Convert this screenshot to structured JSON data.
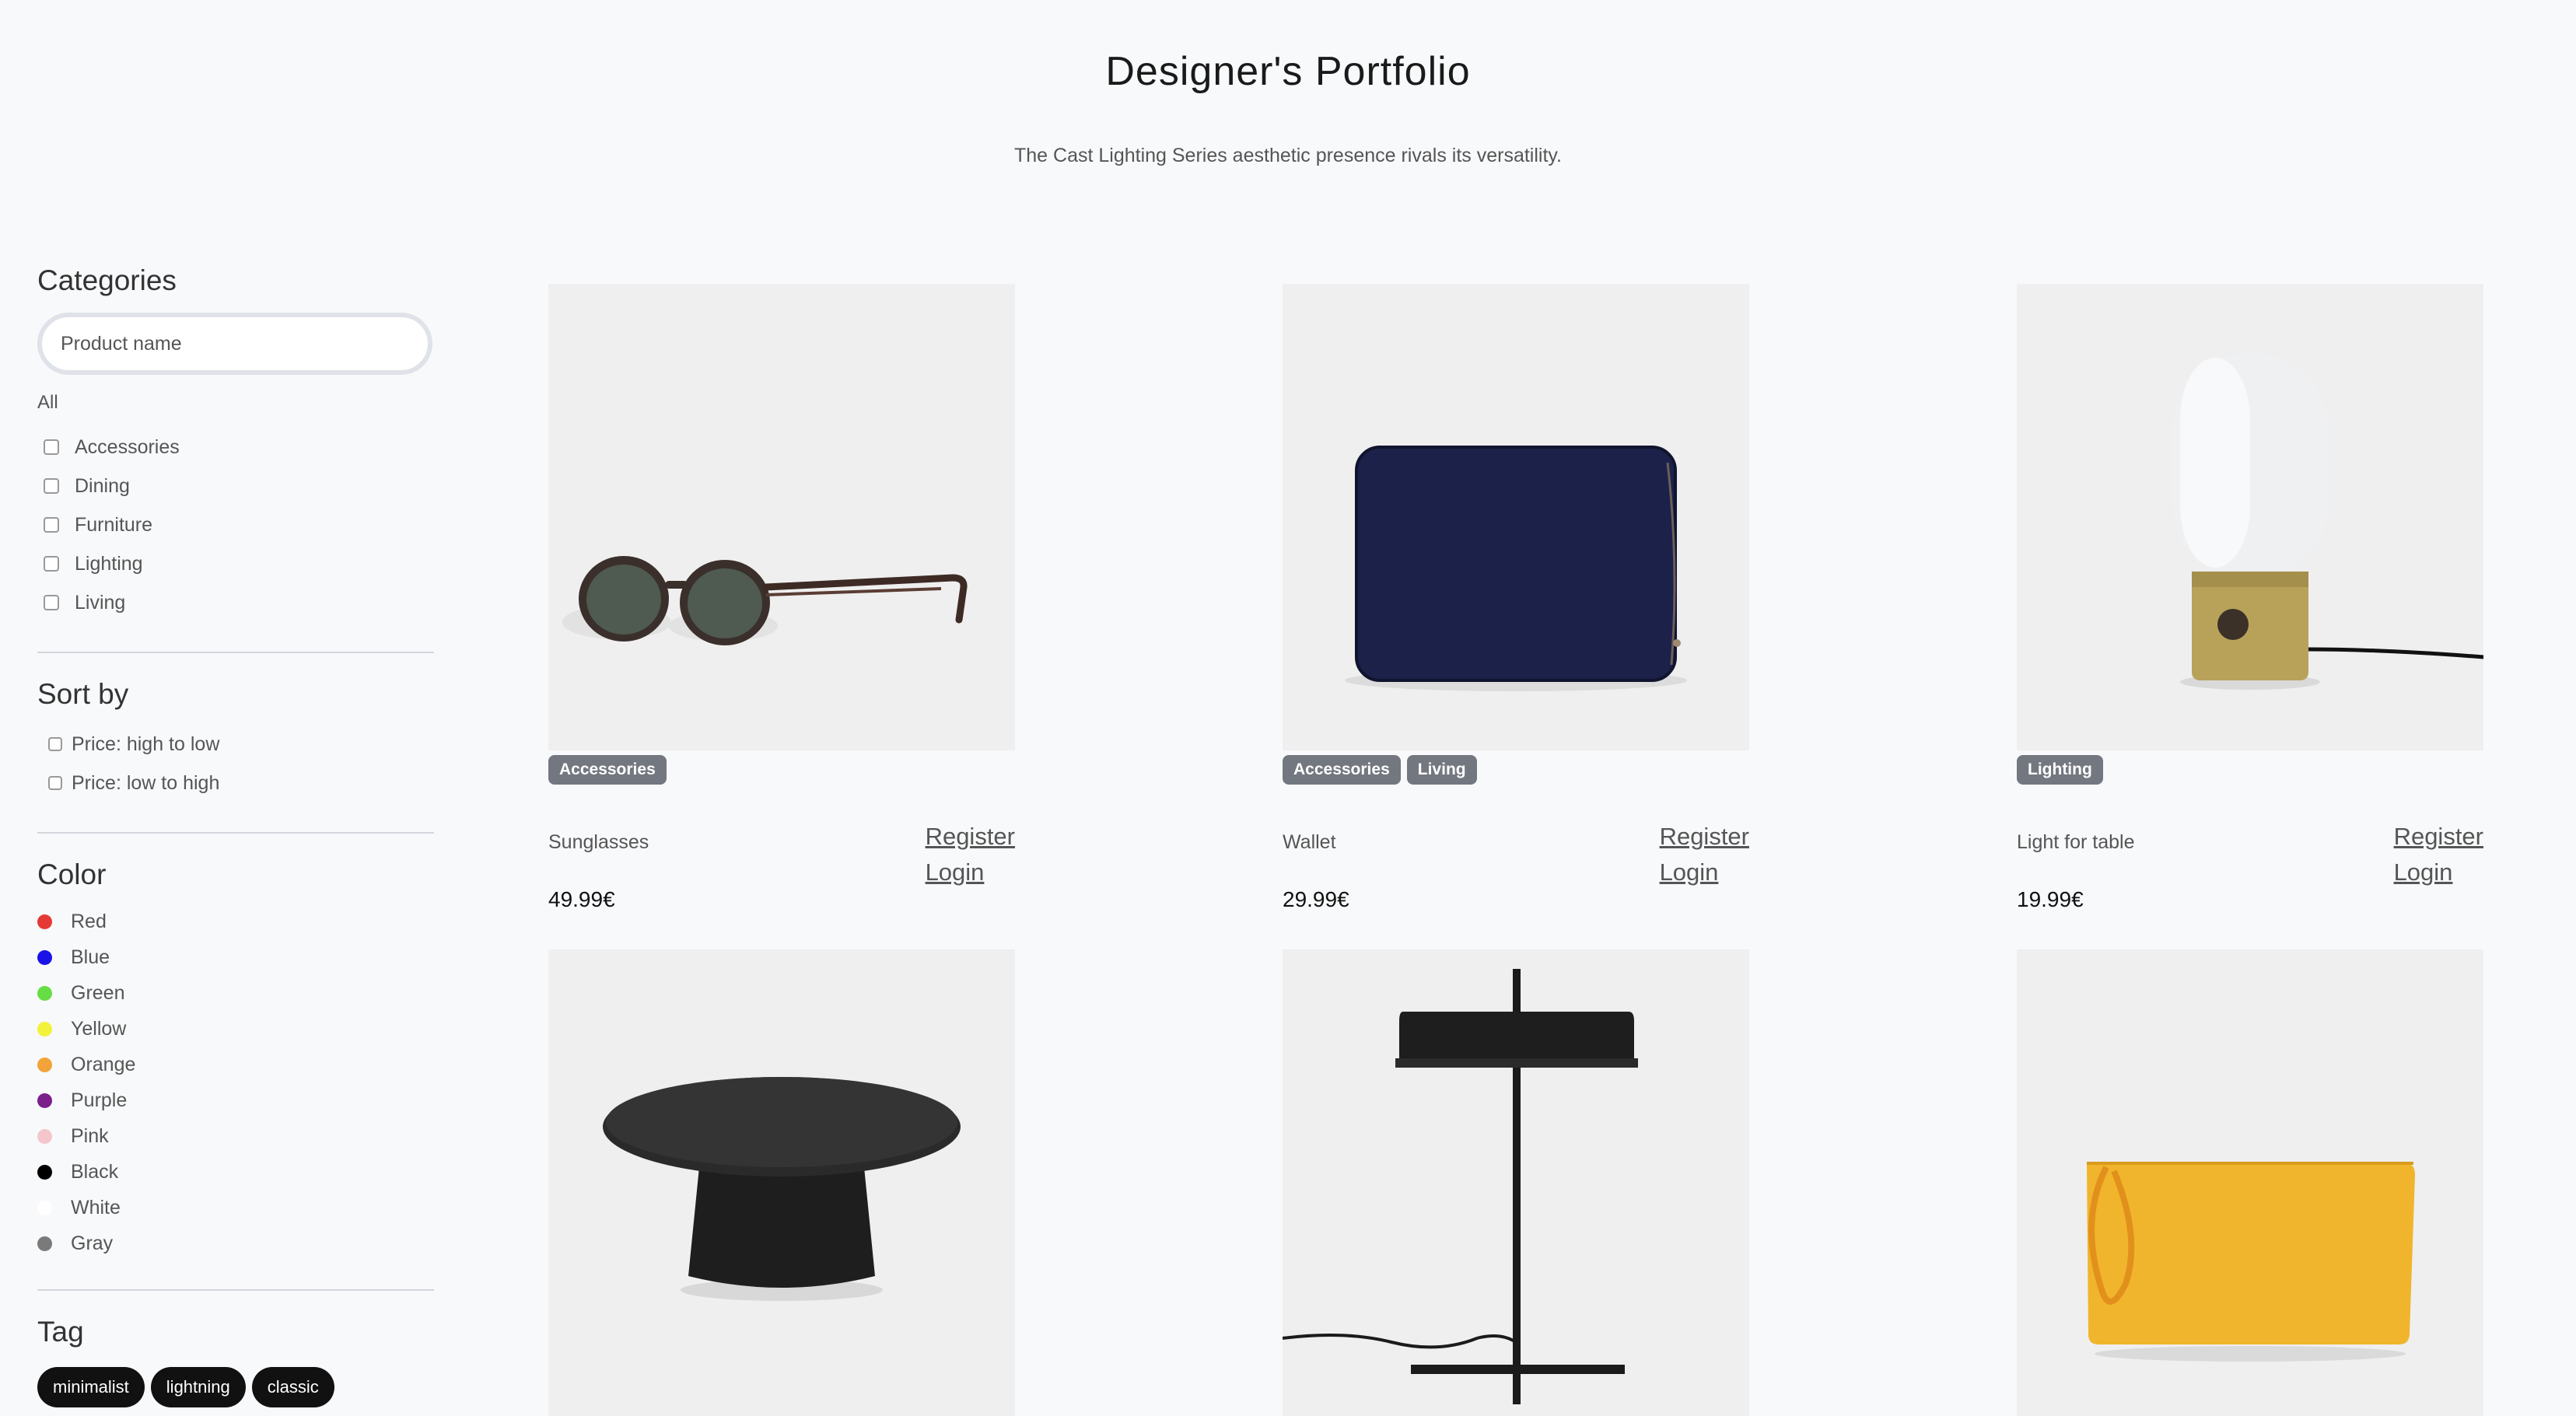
{
  "header": {
    "title": "Designer's Portfolio",
    "subtitle": "The Cast Lighting Series aesthetic presence rivals its versatility."
  },
  "sidebar": {
    "categories": {
      "heading": "Categories",
      "search_placeholder": "Product name",
      "all_label": "All",
      "items": [
        "Accessories",
        "Dining",
        "Furniture",
        "Lighting",
        "Living"
      ]
    },
    "sort": {
      "heading": "Sort by",
      "items": [
        "Price: high to low",
        "Price: low to high"
      ]
    },
    "color": {
      "heading": "Color",
      "items": [
        {
          "label": "Red",
          "hex": "#e53935"
        },
        {
          "label": "Blue",
          "hex": "#1a12e6"
        },
        {
          "label": "Green",
          "hex": "#66dd44"
        },
        {
          "label": "Yellow",
          "hex": "#f2f23a"
        },
        {
          "label": "Orange",
          "hex": "#f2a33a"
        },
        {
          "label": "Purple",
          "hex": "#7b1f8a"
        },
        {
          "label": "Pink",
          "hex": "#f4c6cc"
        },
        {
          "label": "Black",
          "hex": "#000000"
        },
        {
          "label": "White",
          "hex": "#ffffff"
        },
        {
          "label": "Gray",
          "hex": "#7a7a7a"
        }
      ]
    },
    "tag": {
      "heading": "Tag",
      "items": [
        "minimalist",
        "lightning",
        "classic"
      ]
    }
  },
  "products": [
    {
      "name": "Sunglasses",
      "price": "49.99€",
      "badges": [
        "Accessories"
      ],
      "register_label": "Register",
      "login_label": "Login",
      "icon": "sunglasses-image"
    },
    {
      "name": "Wallet",
      "price": "29.99€",
      "badges": [
        "Accessories",
        "Living"
      ],
      "register_label": "Register",
      "login_label": "Login",
      "icon": "wallet-image"
    },
    {
      "name": "Light for table",
      "price": "19.99€",
      "badges": [
        "Lighting"
      ],
      "register_label": "Register",
      "login_label": "Login",
      "icon": "lamp-image"
    },
    {
      "name": "",
      "price": "",
      "badges": [],
      "icon": "coffee-table-image"
    },
    {
      "name": "",
      "price": "",
      "badges": [],
      "icon": "desk-lamp-image"
    },
    {
      "name": "",
      "price": "",
      "badges": [],
      "icon": "yellow-pouch-image"
    }
  ],
  "colors": {
    "page_bg": "#f8f9fb",
    "tag_bg": "#111111",
    "badge_bg": "#737780"
  }
}
